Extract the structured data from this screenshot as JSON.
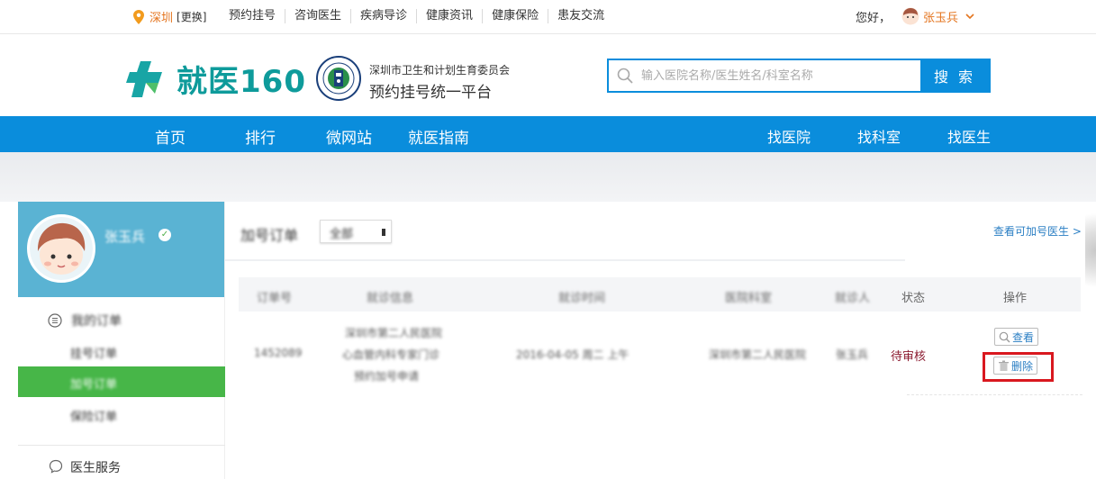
{
  "topbar": {
    "city": "深圳",
    "change": "[更换]",
    "links": [
      "预约挂号",
      "咨询医生",
      "疾病导诊",
      "健康资讯",
      "健康保险",
      "患友交流"
    ],
    "greeting": "您好，",
    "username": "张玉兵"
  },
  "header": {
    "logo_text": "就医160",
    "gov_line1": "深圳市卫生和计划生育委员会",
    "gov_line2": "预约挂号统一平台",
    "search_placeholder": "输入医院名称/医生姓名/科室名称",
    "search_button": "搜 索"
  },
  "nav": {
    "left": [
      "首页",
      "排行",
      "微网站",
      "就医指南"
    ],
    "right": [
      "找医院",
      "找科室",
      "找医生"
    ]
  },
  "sidebar": {
    "profile_name": "张玉兵",
    "menu_head": "我的订单",
    "items": [
      "挂号订单",
      "加号订单",
      "保险订单"
    ],
    "service": "医生服务"
  },
  "main": {
    "title": "加号订单",
    "filter_value": "全部",
    "link": "查看可加号医生 >",
    "columns": [
      "订单号",
      "就诊信息",
      "就诊时间",
      "医院科室",
      "就诊人",
      "状态",
      "操作"
    ],
    "row": {
      "order_no": "1452089",
      "info_l1": "深圳市第二人民医院",
      "info_l2": "心血管内科专家门诊",
      "info_l3": "预约加号申请",
      "time": "2016-04-05 周二 上午",
      "hospital": "深圳市第二人民医院",
      "patient": "张玉兵",
      "status": "待审核",
      "view_btn": "查看",
      "delete_btn": "删除"
    }
  },
  "colors": {
    "brand_blue": "#0a8ddc",
    "brand_green": "#47b648",
    "accent_orange": "#e4751f",
    "highlight_red": "#d9181f"
  }
}
